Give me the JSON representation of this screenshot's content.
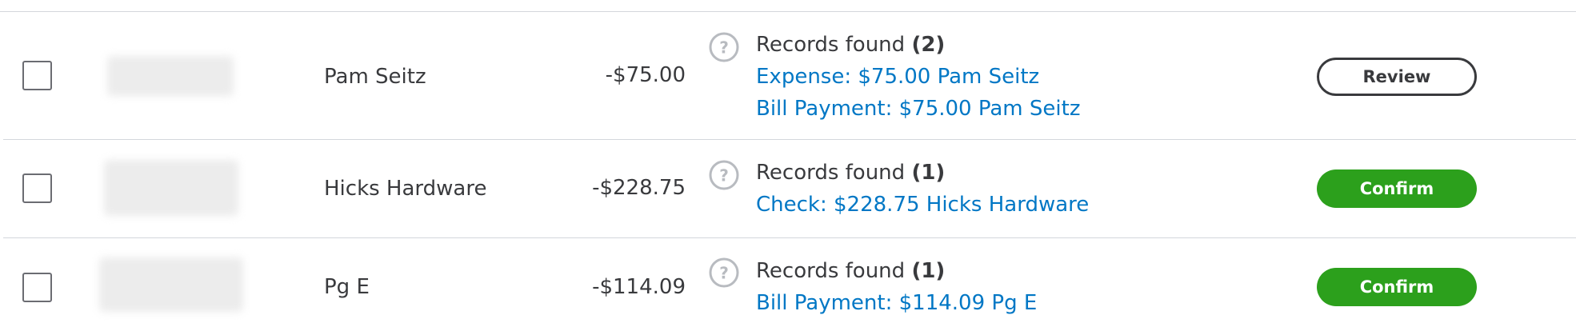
{
  "rows": [
    {
      "payee": "Pam Seitz",
      "amount": "-$75.00",
      "records_label": "Records found",
      "records_count": "(2)",
      "matches": [
        "Expense: $75.00 Pam Seitz",
        "Bill Payment: $75.00 Pam Seitz"
      ],
      "action": "Review"
    },
    {
      "payee": "Hicks Hardware",
      "amount": "-$228.75",
      "records_label": "Records found",
      "records_count": "(1)",
      "matches": [
        "Check: $228.75 Hicks Hardware"
      ],
      "action": "Confirm"
    },
    {
      "payee": "Pg E",
      "amount": "-$114.09",
      "records_label": "Records found",
      "records_count": "(1)",
      "matches": [
        "Bill Payment: $114.09 Pg E"
      ],
      "action": "Confirm"
    }
  ],
  "colors": {
    "link": "#0077c5",
    "confirm": "#2ca01c",
    "text": "#393a3d",
    "divider": "#d4d7dc"
  },
  "icons": {
    "help": "question-circle-icon"
  }
}
